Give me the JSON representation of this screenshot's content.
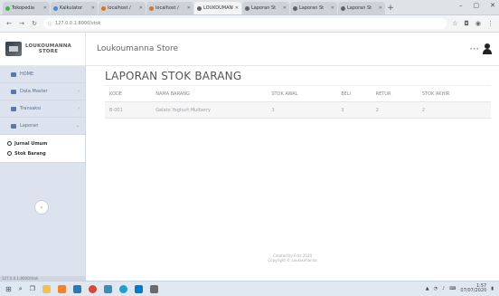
{
  "browser": {
    "tabs": [
      {
        "label": "Tokopedia",
        "active": false
      },
      {
        "label": "Kalkulator",
        "active": false
      },
      {
        "label": "localhost /",
        "active": false
      },
      {
        "label": "localhost /",
        "active": false
      },
      {
        "label": "LOUKOUMANNA",
        "active": true
      },
      {
        "label": "Laporan St",
        "active": false
      },
      {
        "label": "Laporan St",
        "active": false
      },
      {
        "label": "Laporan St",
        "active": false
      }
    ],
    "new_tab": "+",
    "address": "127.0.0.1:8000/stok",
    "window_controls": {
      "minimize": "–",
      "maximize": "▢",
      "close": "✕"
    }
  },
  "app": {
    "brand_line1": "LOUKOUMANNA",
    "brand_line2": "STORE",
    "store_name": "Loukoumanna Store",
    "user_dots": "•••"
  },
  "sidebar": {
    "items": [
      {
        "label": "HOME",
        "chevron": ""
      },
      {
        "label": "Data Master",
        "chevron": "›"
      },
      {
        "label": "Transaksi",
        "chevron": "›"
      },
      {
        "label": "Laporan",
        "chevron": "⌄"
      }
    ],
    "submenu": [
      {
        "label": "Jurnal Umum"
      },
      {
        "label": "Stok Barang"
      }
    ],
    "collapse_icon": "‹",
    "status_text": "127.0.0.1:8000/stok"
  },
  "main": {
    "title": "LAPORAN STOK BARANG",
    "table": {
      "headers": [
        "KODE",
        "NAMA BARANG",
        "STOK AWAL",
        "BELI",
        "RETUR",
        "STOK AKHIR"
      ],
      "rows": [
        [
          "B-001",
          "Gelato Yoghurt Mulberry",
          "3",
          "3",
          "2",
          "2"
        ]
      ]
    },
    "footer_line1": "Created by Fritz 2020",
    "footer_line2": "Copyright © Loukoumanna"
  },
  "taskbar": {
    "tray_text": "",
    "time": "1:57",
    "date": "07/07/2020"
  },
  "colors": {
    "sidebar_bg": "#dde3ee",
    "sidebar_text": "#5a6f8f",
    "taskbar_bg": "#dfe7f1"
  }
}
